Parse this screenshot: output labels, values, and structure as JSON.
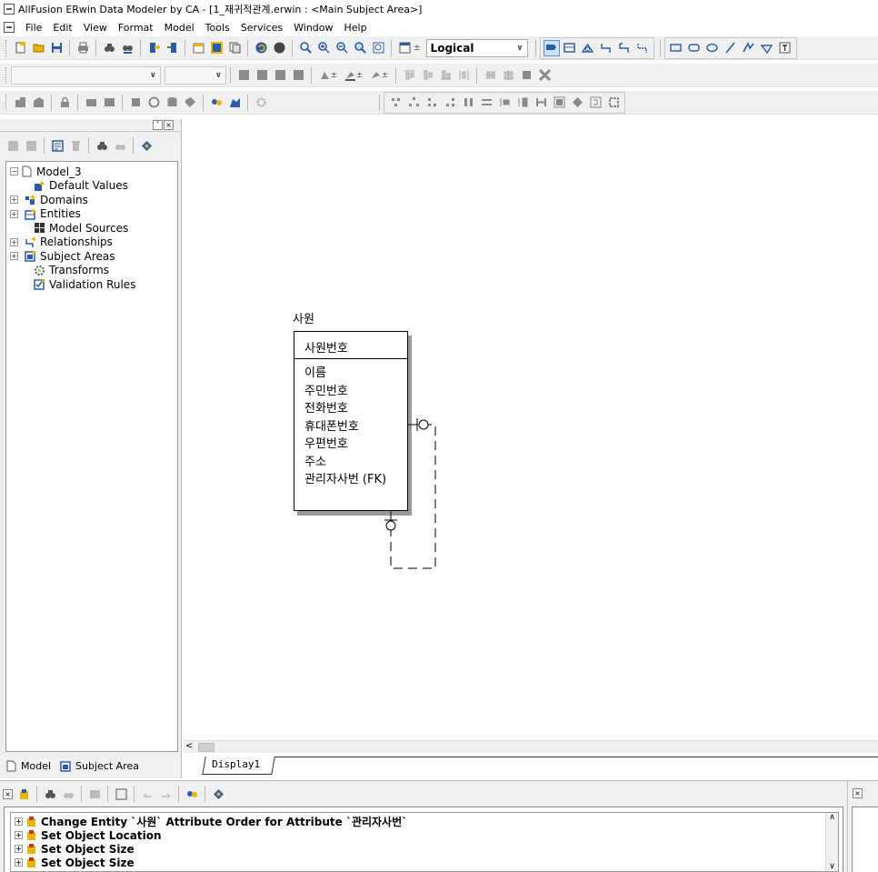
{
  "window": {
    "title": "AllFusion ERwin Data Modeler by CA - [1_재귀적관계.erwin : <Main Subject Area>]"
  },
  "menu": [
    "File",
    "Edit",
    "View",
    "Format",
    "Model",
    "Tools",
    "Services",
    "Window",
    "Help"
  ],
  "toolbar": {
    "view_mode": "Logical",
    "colors": {
      "bar_bg": "#f0f0f0",
      "accent_blue": "#2a5cab",
      "accent_yellow": "#e8b400"
    }
  },
  "model_tree": {
    "root": "Model_3",
    "items": [
      {
        "label": "Default Values",
        "expandable": false,
        "icon": "default-values-icon"
      },
      {
        "label": "Domains",
        "expandable": true,
        "icon": "domains-icon"
      },
      {
        "label": "Entities",
        "expandable": true,
        "icon": "entities-icon"
      },
      {
        "label": "Model Sources",
        "expandable": false,
        "icon": "model-sources-icon"
      },
      {
        "label": "Relationships",
        "expandable": true,
        "icon": "relationships-icon"
      },
      {
        "label": "Subject Areas",
        "expandable": true,
        "icon": "subject-areas-icon"
      },
      {
        "label": "Transforms",
        "expandable": false,
        "icon": "transforms-icon"
      },
      {
        "label": "Validation Rules",
        "expandable": false,
        "icon": "validation-rules-icon"
      }
    ],
    "tabs": [
      "Model",
      "Subject Area"
    ]
  },
  "diagram": {
    "display_tab": "Display1",
    "entity": {
      "name": "사원",
      "primary_key": "사원번호",
      "attributes": [
        "이름",
        "주민번호",
        "전화번호",
        "휴대폰번호",
        "우편번호",
        "주소",
        "관리자사번 (FK)"
      ]
    }
  },
  "action_log": {
    "items": [
      "Change Entity `사원` Attribute Order for Attribute `관리자사번`",
      "Set Object Location",
      "Set Object Size",
      "Set Object Size"
    ]
  }
}
